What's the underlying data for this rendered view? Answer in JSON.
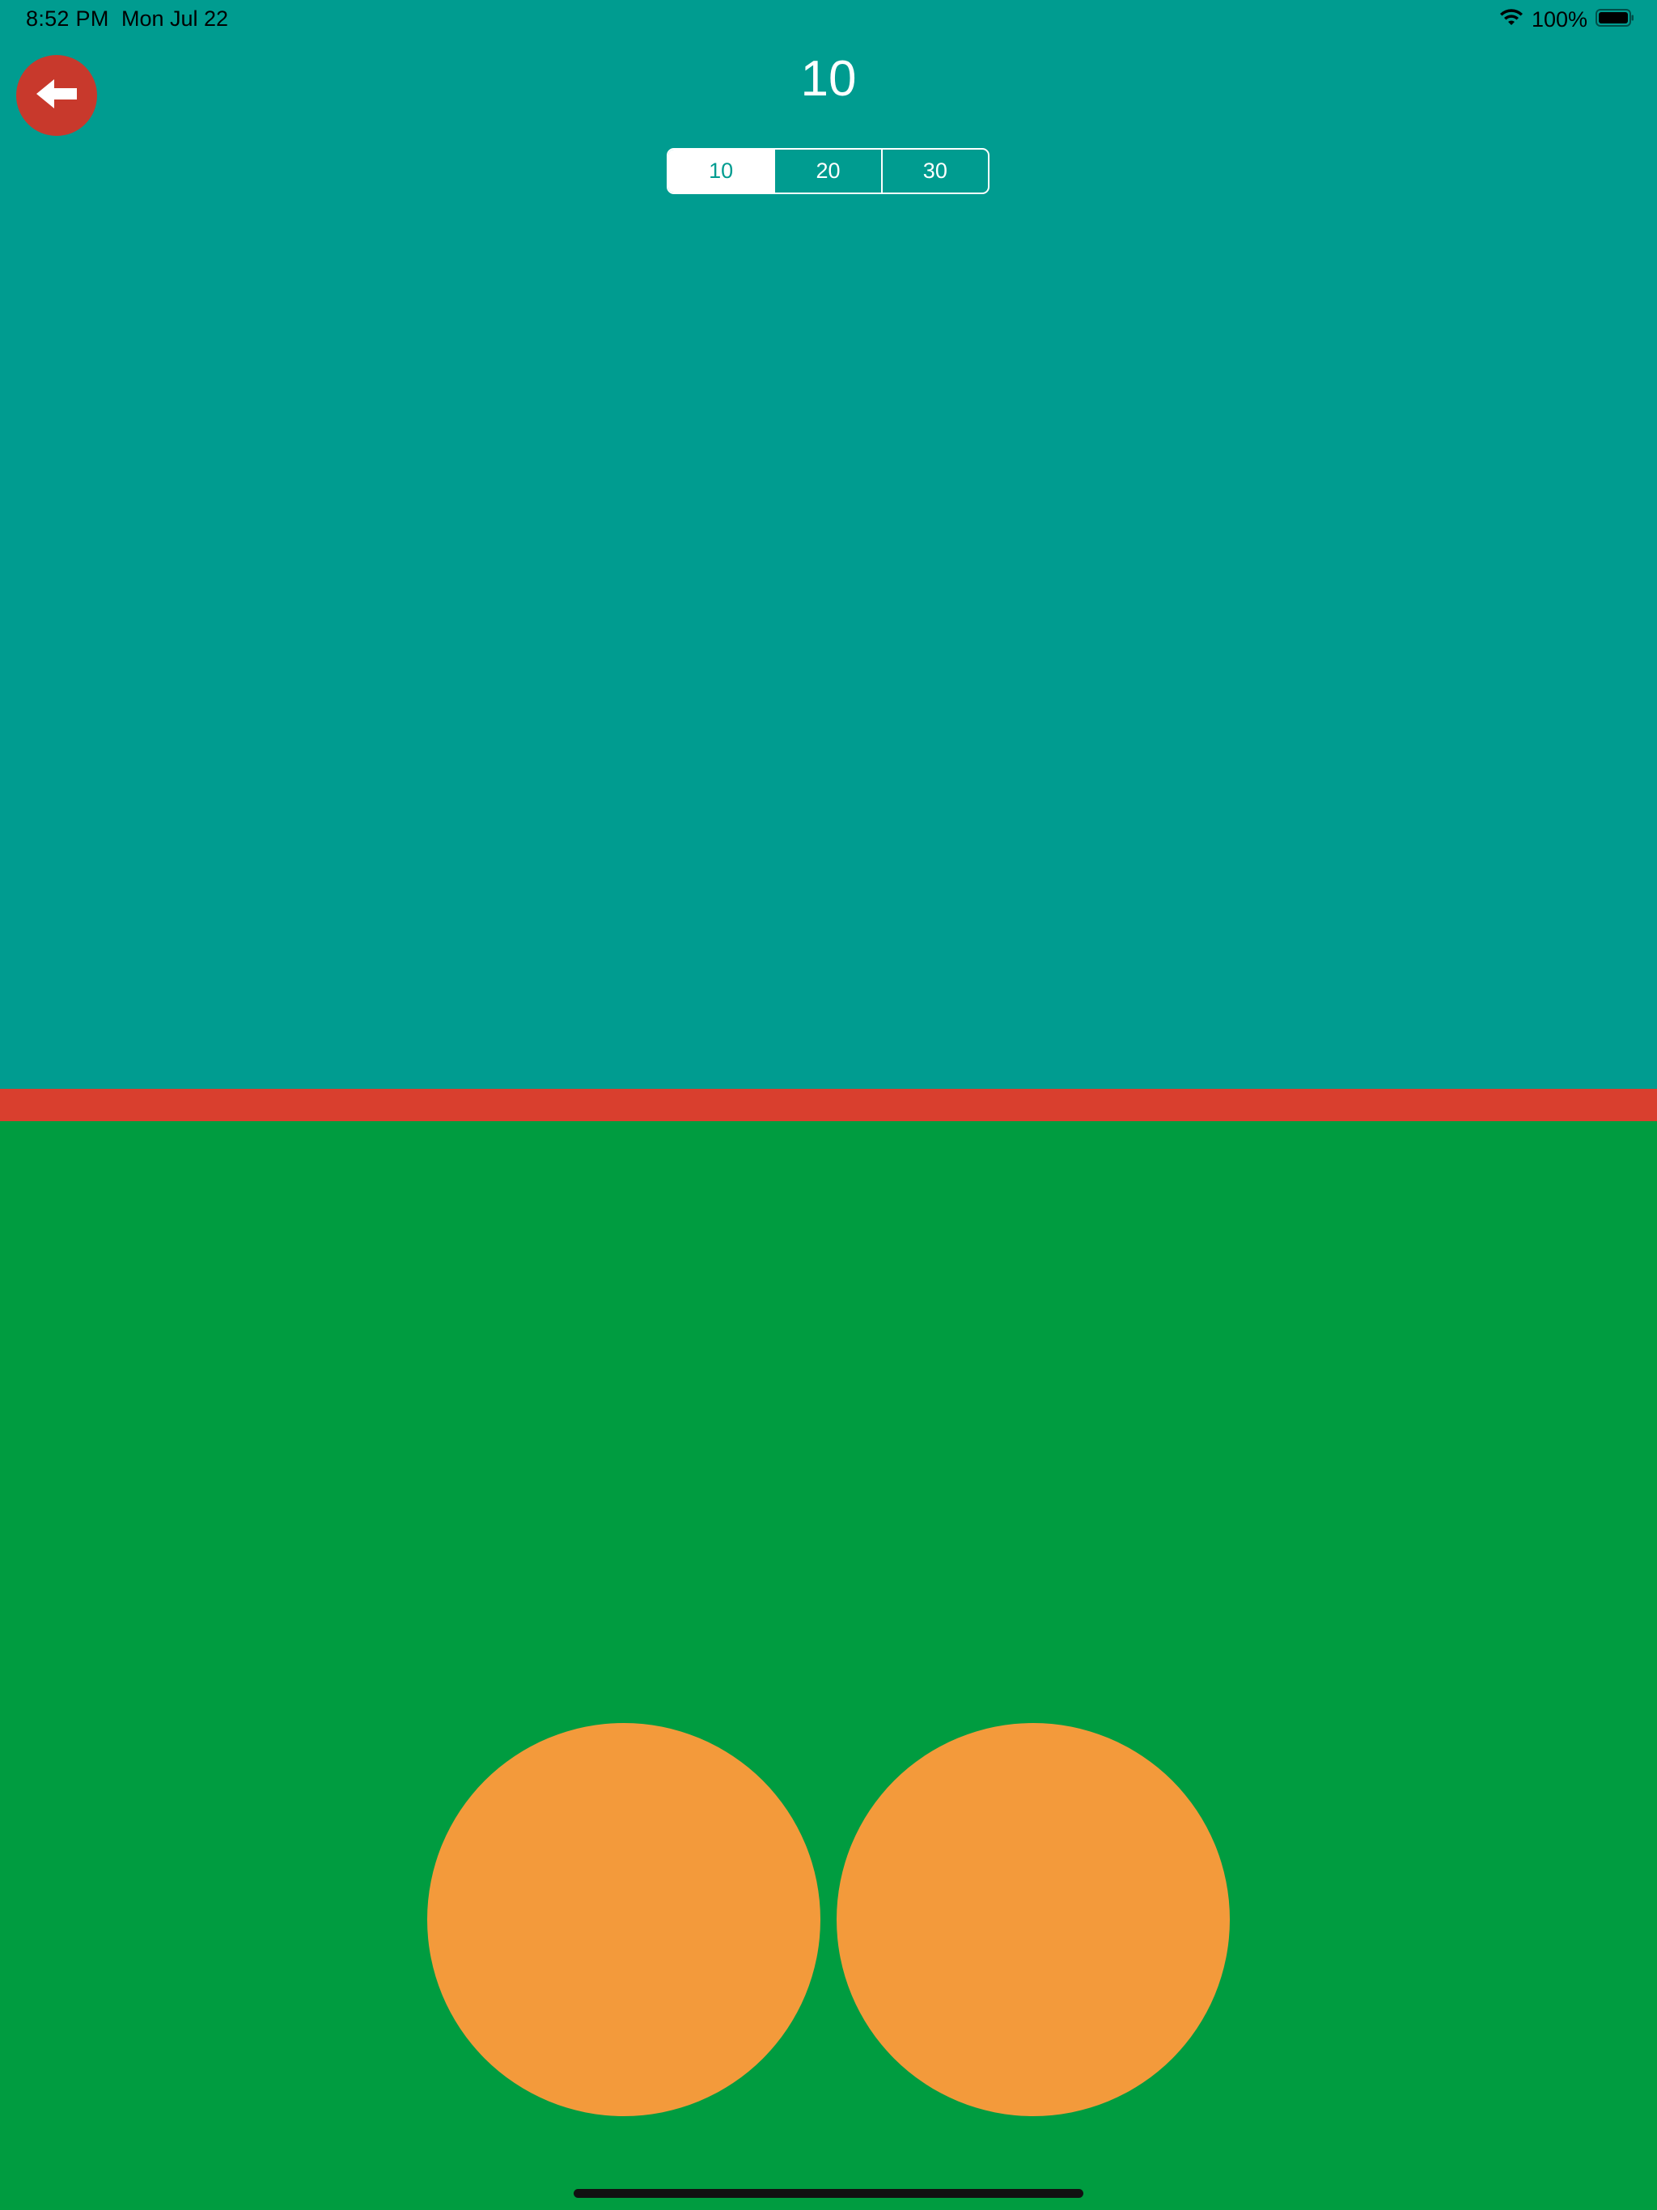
{
  "status_bar": {
    "time": "8:52 PM",
    "date": "Mon Jul 22",
    "battery_percent": "100%",
    "icons": [
      "wifi-icon",
      "battery-icon"
    ]
  },
  "header": {
    "back_icon": "arrow-left-icon",
    "round_value": "10",
    "segments": [
      {
        "label": "10",
        "selected": true
      },
      {
        "label": "20",
        "selected": false
      },
      {
        "label": "30",
        "selected": false
      }
    ]
  },
  "colors": {
    "top_area": "#009c90",
    "divider": "#d93f2e",
    "bottom_area": "#009c40",
    "pad": "#f39a3b",
    "back_button": "#c8392c"
  },
  "pads": {
    "count": 2
  }
}
